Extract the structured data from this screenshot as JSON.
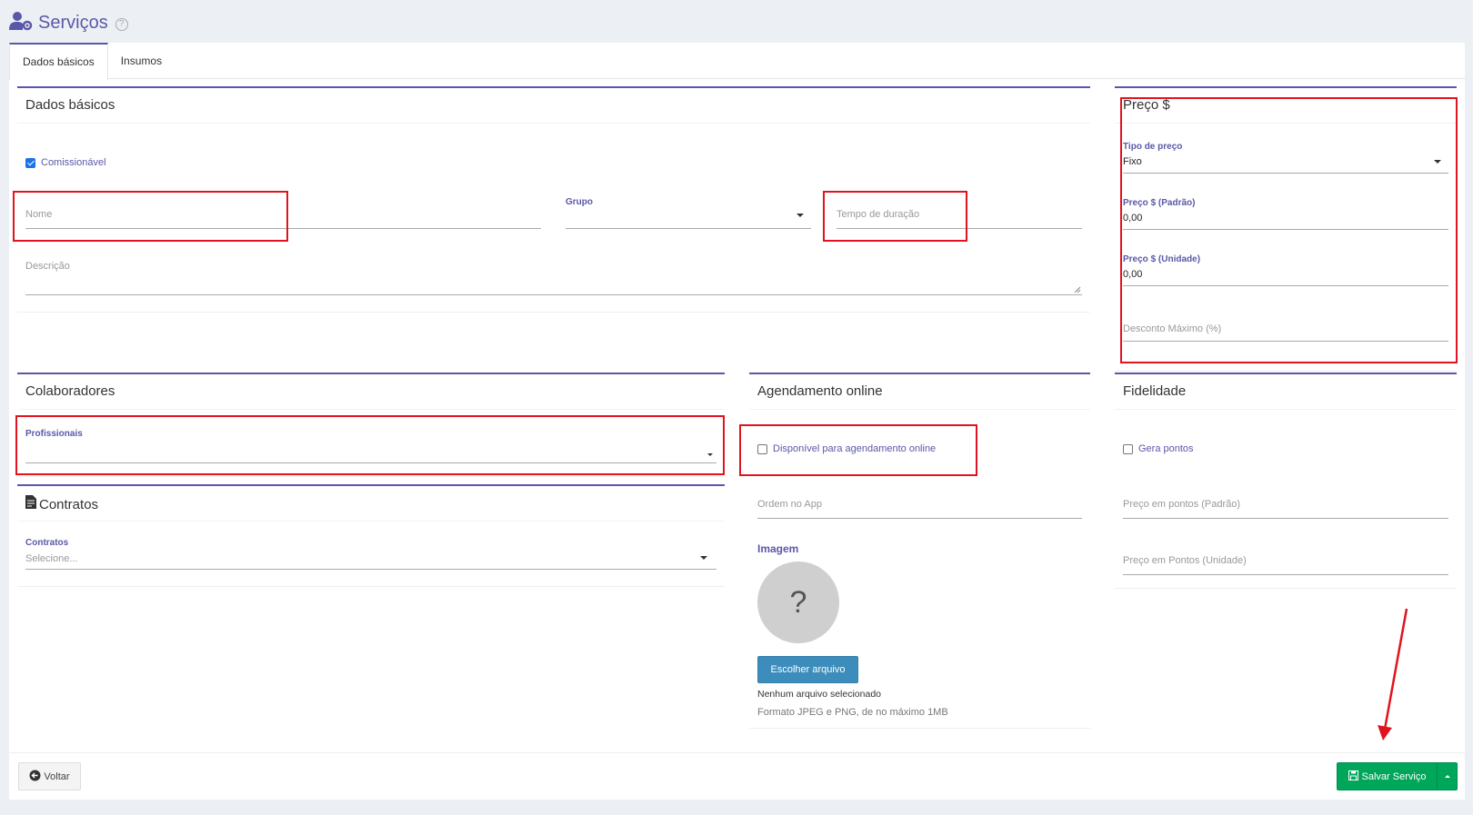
{
  "header": {
    "title": "Serviços",
    "help": "?"
  },
  "tabs": [
    {
      "label": "Dados básicos",
      "active": true
    },
    {
      "label": "Insumos",
      "active": false
    }
  ],
  "dados_basicos": {
    "title": "Dados básicos",
    "comissionavel": {
      "label": "Comissionável",
      "checked": true
    },
    "nome": {
      "placeholder": "Nome",
      "value": ""
    },
    "grupo": {
      "label": "Grupo",
      "value": ""
    },
    "tempo": {
      "placeholder": "Tempo de duração",
      "value": ""
    },
    "descricao": {
      "placeholder": "Descrição",
      "value": ""
    }
  },
  "preco": {
    "title": "Preço $",
    "tipo": {
      "label": "Tipo de preço",
      "value": "Fixo"
    },
    "padrao": {
      "label": "Preço $ (Padrão)",
      "value": "0,00"
    },
    "unidade": {
      "label": "Preço $ (Unidade)",
      "value": "0,00"
    },
    "desconto": {
      "placeholder": "Desconto Máximo (%)",
      "value": ""
    }
  },
  "colaboradores": {
    "title": "Colaboradores",
    "profissionais": {
      "label": "Profissionais",
      "value": ""
    }
  },
  "contratos": {
    "title": "Contratos",
    "field": {
      "label": "Contratos",
      "placeholder": "Selecione..."
    }
  },
  "agendamento": {
    "title": "Agendamento online",
    "disponivel": {
      "label": "Disponível para agendamento online",
      "checked": false
    },
    "ordem": {
      "placeholder": "Ordem no App",
      "value": ""
    },
    "imagem": {
      "label": "Imagem",
      "placeholder_glyph": "?",
      "button": "Escolher arquivo",
      "no_file": "Nenhum arquivo selecionado",
      "hint": "Formato JPEG e PNG, de no máximo 1MB"
    }
  },
  "fidelidade": {
    "title": "Fidelidade",
    "gera_pontos": {
      "label": "Gera pontos",
      "checked": false
    },
    "pontos_padrao": {
      "placeholder": "Preço em pontos (Padrão)"
    },
    "pontos_unidade": {
      "placeholder": "Preço em Pontos (Unidade)"
    }
  },
  "footer": {
    "back": "Voltar",
    "save": "Salvar Serviço"
  },
  "colors": {
    "accent": "#5b57a8",
    "annotation": "#e0141e",
    "save": "#00a65a",
    "file_button": "#3c8dbc"
  },
  "icons": [
    "user-gear-icon",
    "help-circle-icon",
    "contract-icon",
    "arrow-left-circle-icon",
    "save-icon",
    "caret-down-icon",
    "caret-up-icon"
  ]
}
